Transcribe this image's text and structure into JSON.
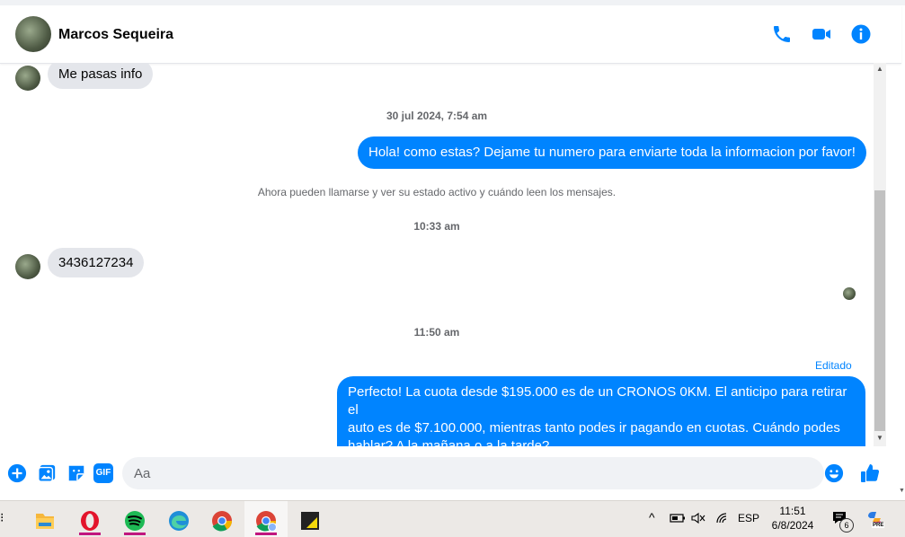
{
  "contact": {
    "name": "Marcos Sequeira"
  },
  "messages": [
    {
      "type": "in",
      "text": "Me pasas info"
    },
    {
      "type": "ts",
      "date": "30 jul 2024,",
      "time": "7:54 am"
    },
    {
      "type": "out",
      "text": "Hola! como estas? Dejame tu numero para enviarte toda la informacion por favor!"
    },
    {
      "type": "notice",
      "text": "Ahora pueden llamarse y ver su estado activo y cuándo leen los mensajes."
    },
    {
      "type": "ts",
      "time": "10:33 am"
    },
    {
      "type": "in",
      "text": "3436127234"
    },
    {
      "type": "ts",
      "time": "11:50 am"
    },
    {
      "type": "edited",
      "text": "Editado"
    },
    {
      "type": "out",
      "lines": [
        "Perfecto! La cuota desde $195.000 es de un CRONOS 0KM. El anticipo para retirar el",
        "auto es de $7.100.000, mientras tanto podes ir pagando en cuotas. Cuándo podes",
        "hablar? A la mañana o a la tarde?"
      ]
    }
  ],
  "composer": {
    "placeholder": "Aa",
    "gif_label": "GIF"
  },
  "taskbar": {
    "language": "ESP",
    "time": "11:51",
    "date": "6/8/2024",
    "notification_count": "6",
    "copilot_badge": "PRE"
  },
  "colors": {
    "accent": "#0084ff",
    "incoming_bubble": "#e4e6eb"
  }
}
